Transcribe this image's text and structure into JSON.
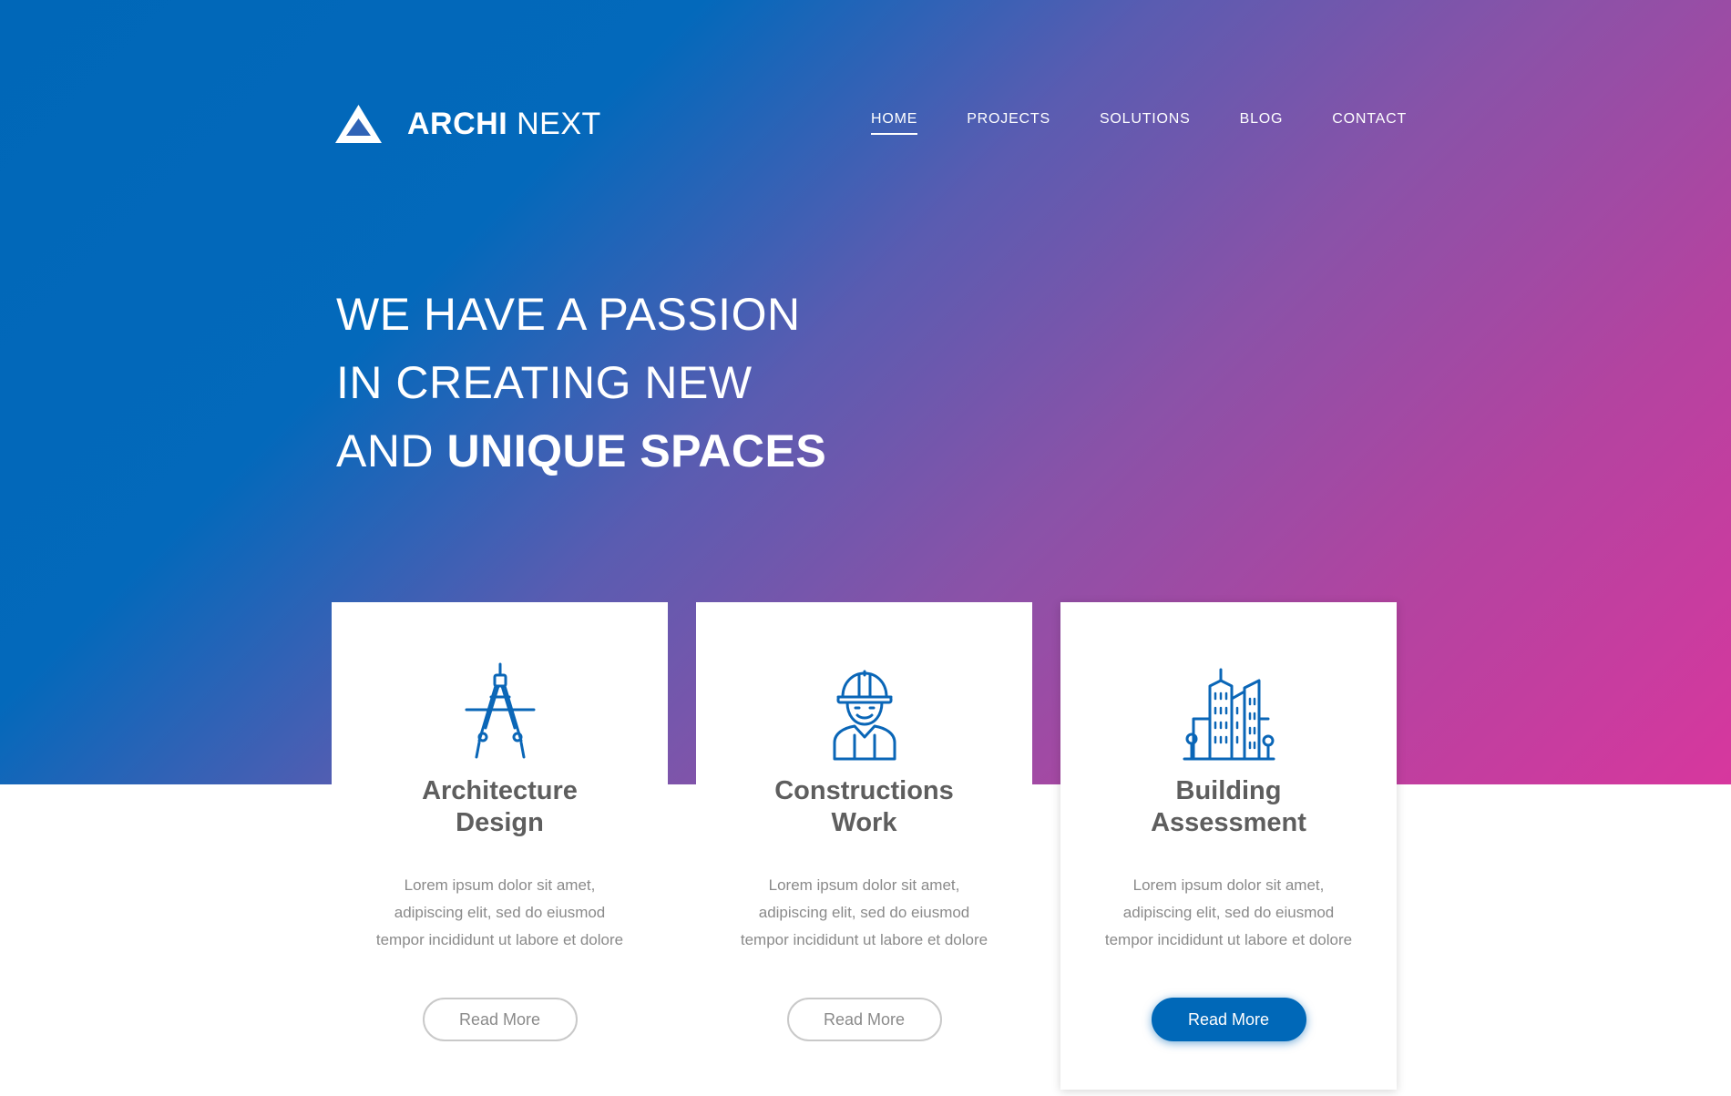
{
  "brand": {
    "name_bold": "ARCHI",
    "name_light": "NEXT",
    "icon": "triangle-logo-icon"
  },
  "nav": {
    "items": [
      {
        "label": "HOME",
        "active": true
      },
      {
        "label": "PROJECTS",
        "active": false
      },
      {
        "label": "SOLUTIONS",
        "active": false
      },
      {
        "label": "BLOG",
        "active": false
      },
      {
        "label": "CONTACT",
        "active": false
      }
    ]
  },
  "hero": {
    "line1": "WE HAVE A PASSION",
    "line2": "IN CREATING NEW",
    "line3_light": "AND",
    "line3_bold": "UNIQUE SPACES"
  },
  "cards": [
    {
      "icon": "drafting-compass-icon",
      "title_line1": "Architecture",
      "title_line2": "Design",
      "text_line1": "Lorem ipsum dolor sit amet,",
      "text_line2": "adipiscing elit, sed do eiusmod",
      "text_line3": "tempor incididunt ut labore et dolore",
      "button": "Read More"
    },
    {
      "icon": "construction-worker-icon",
      "title_line1": "Constructions",
      "title_line2": "Work",
      "text_line1": "Lorem ipsum dolor sit amet,",
      "text_line2": "adipiscing elit, sed do eiusmod",
      "text_line3": "tempor incididunt ut labore et dolore",
      "button": "Read More"
    },
    {
      "icon": "city-buildings-icon",
      "title_line1": "Building",
      "title_line2": "Assessment",
      "text_line1": "Lorem ipsum dolor sit amet,",
      "text_line2": "adipiscing elit, sed do eiusmod",
      "text_line3": "tempor incididunt ut labore et dolore",
      "button": "Read More"
    }
  ],
  "colors": {
    "gradient_start": "#0067b8",
    "gradient_end": "#d7379e",
    "accent": "#0068b8",
    "title_text": "#5e5e5e",
    "body_text": "#8a8a8a"
  }
}
